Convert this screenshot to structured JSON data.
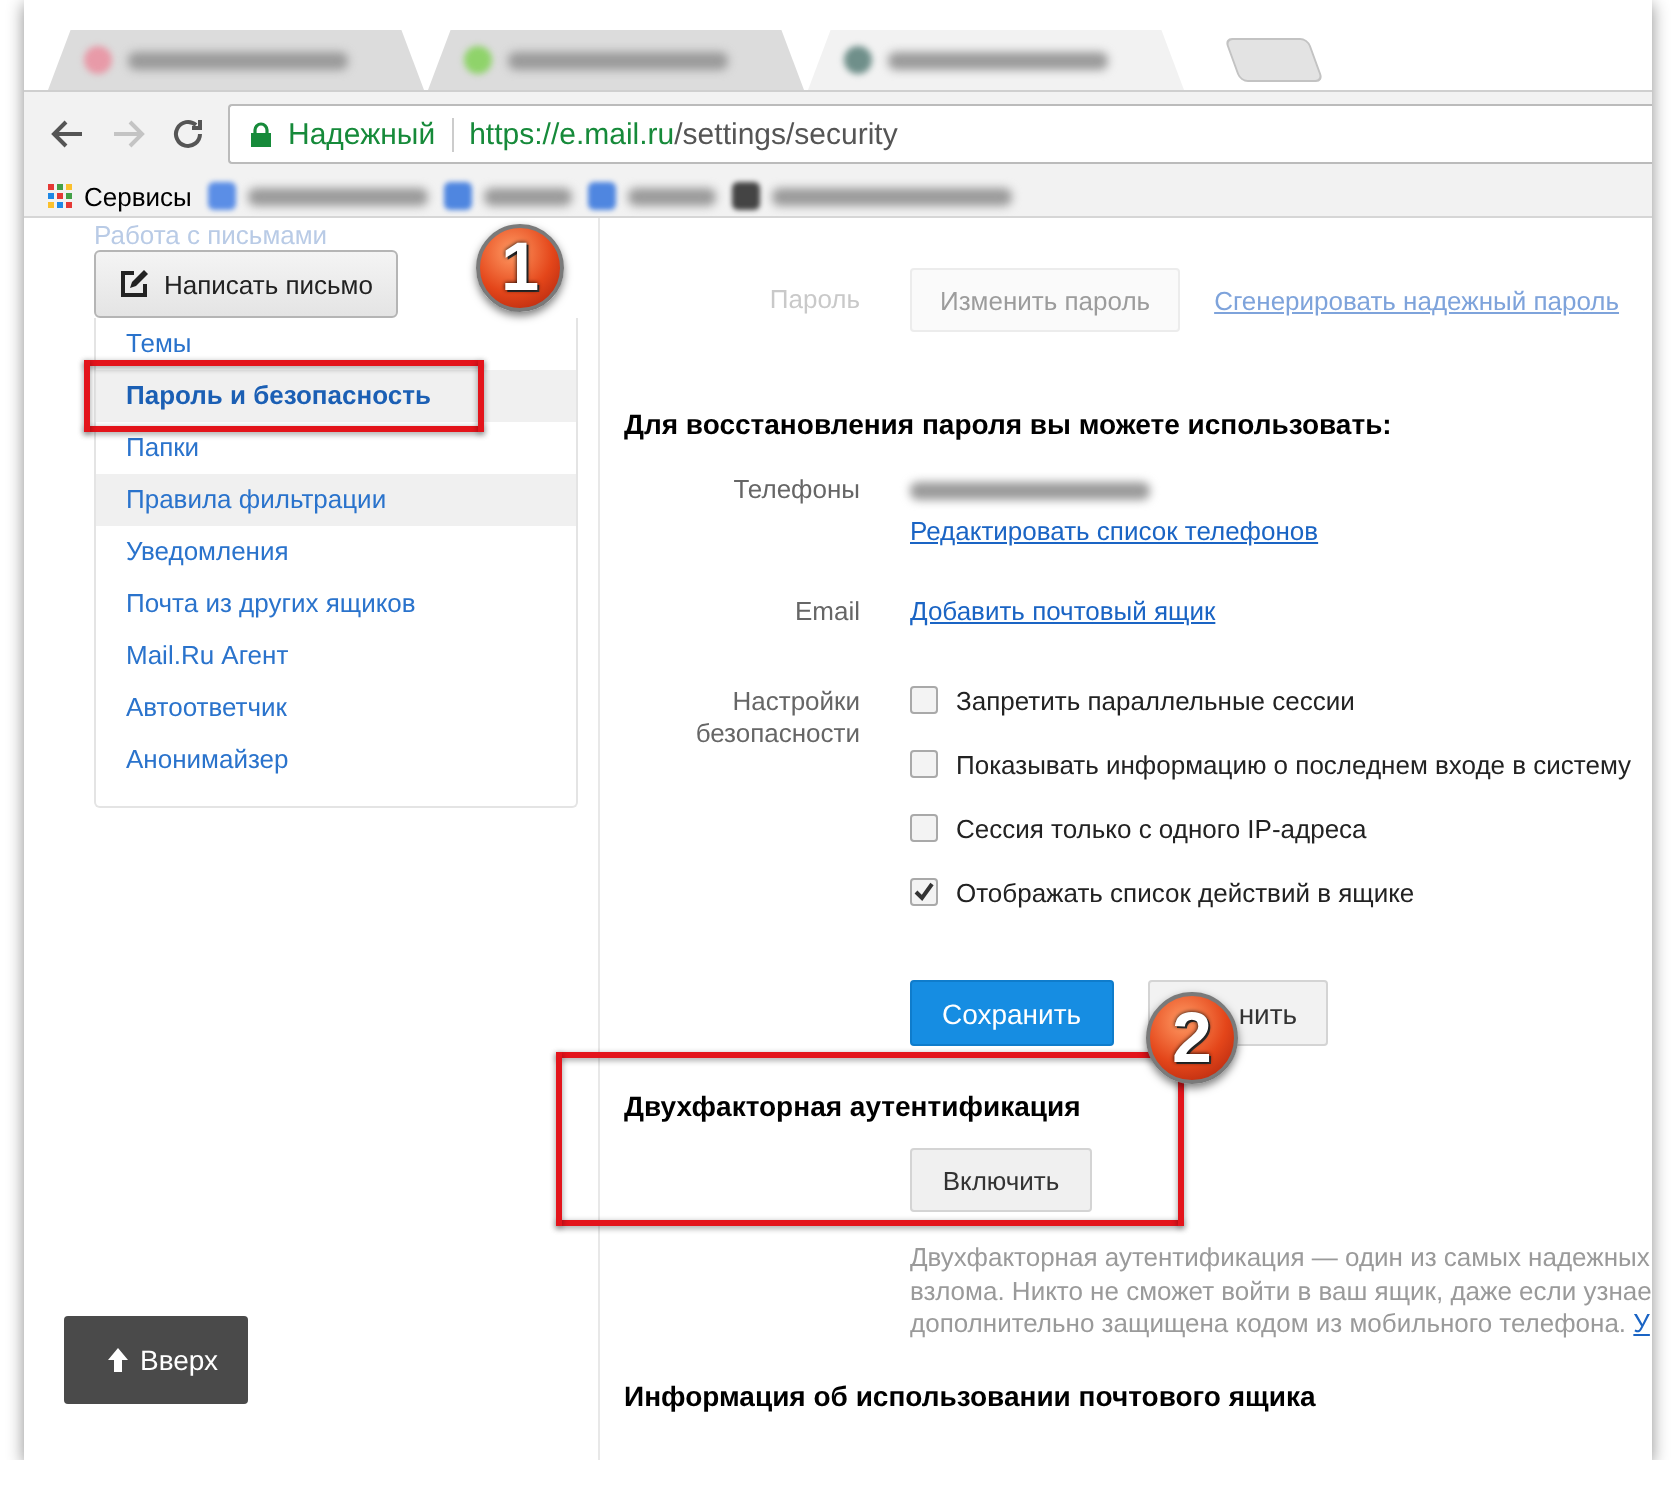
{
  "browser": {
    "tabs": [
      {
        "selected": false,
        "color": "#e89aa8"
      },
      {
        "selected": false,
        "color": "#8fd36a"
      },
      {
        "selected": true,
        "color": "#6f8f8a"
      }
    ],
    "forward_disabled": true,
    "address": {
      "security": "Надежный",
      "host": "https://e.mail.ru",
      "path": "/settings/security"
    },
    "bookmarks": {
      "apps_label": "Сервисы",
      "items": [
        {
          "color": "#5b8ee6"
        },
        {
          "color": "#4f86e0"
        },
        {
          "color": "#4f86e0"
        },
        {
          "color": "#444444"
        }
      ]
    }
  },
  "sidebar": {
    "section_title": "Работа с письмами",
    "compose_button": "Написать письмо",
    "items": [
      {
        "label": "Темы",
        "selected": false,
        "hovered": false
      },
      {
        "label": "Пароль и безопасность",
        "selected": true,
        "hovered": false
      },
      {
        "label": "Папки",
        "selected": false,
        "hovered": false
      },
      {
        "label": "Правила фильтрации",
        "selected": false,
        "hovered": true
      },
      {
        "label": "Уведомления",
        "selected": false,
        "hovered": false
      },
      {
        "label": "Почта из других ящиков",
        "selected": false,
        "hovered": false
      },
      {
        "label": "Mail.Ru Агент",
        "selected": false,
        "hovered": false
      },
      {
        "label": "Автоответчик",
        "selected": false,
        "hovered": false
      },
      {
        "label": "Анонимайзер",
        "selected": false,
        "hovered": false
      }
    ],
    "scroll_top_button": "Вверх"
  },
  "password": {
    "label": "Пароль",
    "button": "Изменить пароль",
    "link": "Сгенерировать надежный пароль"
  },
  "recovery": {
    "title": "Для восстановления пароля вы можете использовать:",
    "phones": {
      "label": "Телефоны",
      "link": "Редактировать список телефонов"
    },
    "email": {
      "label": "Email",
      "link": "Добавить почтовый ящик"
    },
    "security": {
      "label": "Настройки безопасности",
      "options": [
        {
          "label": "Запретить параллельные сессии",
          "checked": false
        },
        {
          "label": "Показывать информацию о последнем входе в систему",
          "checked": false
        },
        {
          "label": "Сессия только с одного IP-адреса",
          "checked": false
        },
        {
          "label": "Отображать список действий в ящике",
          "checked": true
        }
      ]
    }
  },
  "actions": {
    "save": "Сохранить",
    "cancel": "нить"
  },
  "two_factor": {
    "title": "Двухфакторная аутентификация",
    "button": "Включить",
    "description": [
      "Двухфакторная аутентификация — один из самых надежных",
      "взлома. Никто не сможет войти в ваш ящик, даже если узнае",
      "дополнительно защищена кодом из мобильного телефона. "
    ],
    "link": "У"
  },
  "usage": {
    "title": "Информация об использовании почтового ящика"
  },
  "annotations": [
    {
      "number": "1"
    },
    {
      "number": "2"
    }
  ]
}
